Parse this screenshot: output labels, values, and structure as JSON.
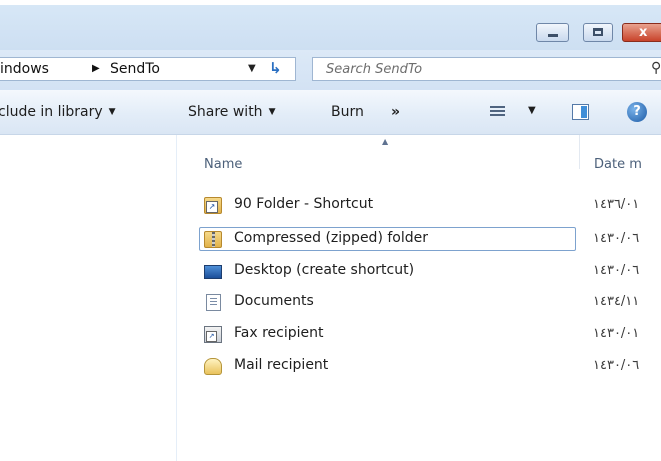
{
  "window": {
    "buttons": {
      "minimize_icon": "minimize-icon",
      "maximize_icon": "maximize-icon",
      "close_glyph": "x"
    }
  },
  "address": {
    "crumbs": [
      "indows",
      "SendTo"
    ],
    "separator_icon": "breadcrumb-arrow-icon",
    "dropdown_icon": "chevron-down-icon",
    "refresh_icon": "refresh-icon"
  },
  "search": {
    "placeholder": "Search SendTo",
    "value": "",
    "icon": "search-icon"
  },
  "toolbar": {
    "include_label": "clude in library",
    "share_label": "Share with",
    "burn_label": "Burn",
    "more_label": "»",
    "views_icon": "view-options-icon",
    "preview_icon": "preview-pane-icon",
    "help_icon": "help-icon"
  },
  "columns": {
    "name": "Name",
    "date": "Date m"
  },
  "files": [
    {
      "name": "90 Folder - Shortcut",
      "date": "١٤٣٦/٠١",
      "icon": "folder-shortcut-icon"
    },
    {
      "name": "Compressed (zipped) folder",
      "date": "١٤٣٠/٠٦",
      "icon": "zip-folder-icon"
    },
    {
      "name": "Desktop (create shortcut)",
      "date": "١٤٣٠/٠٦",
      "icon": "desktop-icon"
    },
    {
      "name": "Documents",
      "date": "١٤٣٤/١١",
      "icon": "documents-icon"
    },
    {
      "name": "Fax recipient",
      "date": "١٤٣٠/٠١",
      "icon": "fax-icon"
    },
    {
      "name": "Mail recipient",
      "date": "١٤٣٠/٠٦",
      "icon": "mail-icon"
    }
  ]
}
